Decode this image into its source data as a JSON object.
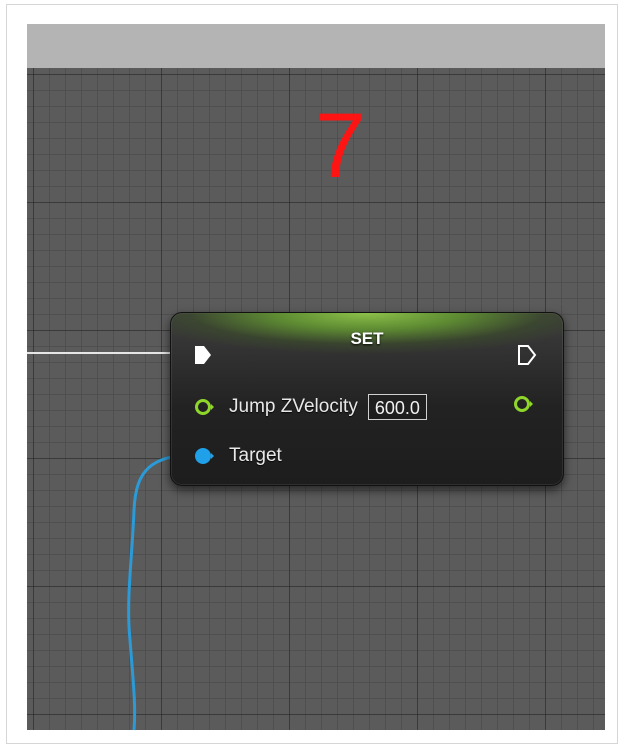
{
  "annotation": {
    "step_number": "7"
  },
  "node": {
    "title": "SET",
    "pins": {
      "jump_zvelocity": {
        "label": "Jump ZVelocity",
        "value": "600.0",
        "color": "#8fd62a"
      },
      "target": {
        "label": "Target",
        "color": "#1fa0e8"
      }
    }
  },
  "colors": {
    "exec_wire": "#e6e6e6",
    "target_wire": "#2b9ad6",
    "node_header": "#6a9a3c",
    "step_number": "#ff1414"
  },
  "icons": {
    "exec_in": "exec-pin-filled",
    "exec_out": "exec-pin-outline",
    "jump_in": "float-pin-ring",
    "jump_out": "float-pin-ring",
    "target_in": "object-pin-filled"
  }
}
